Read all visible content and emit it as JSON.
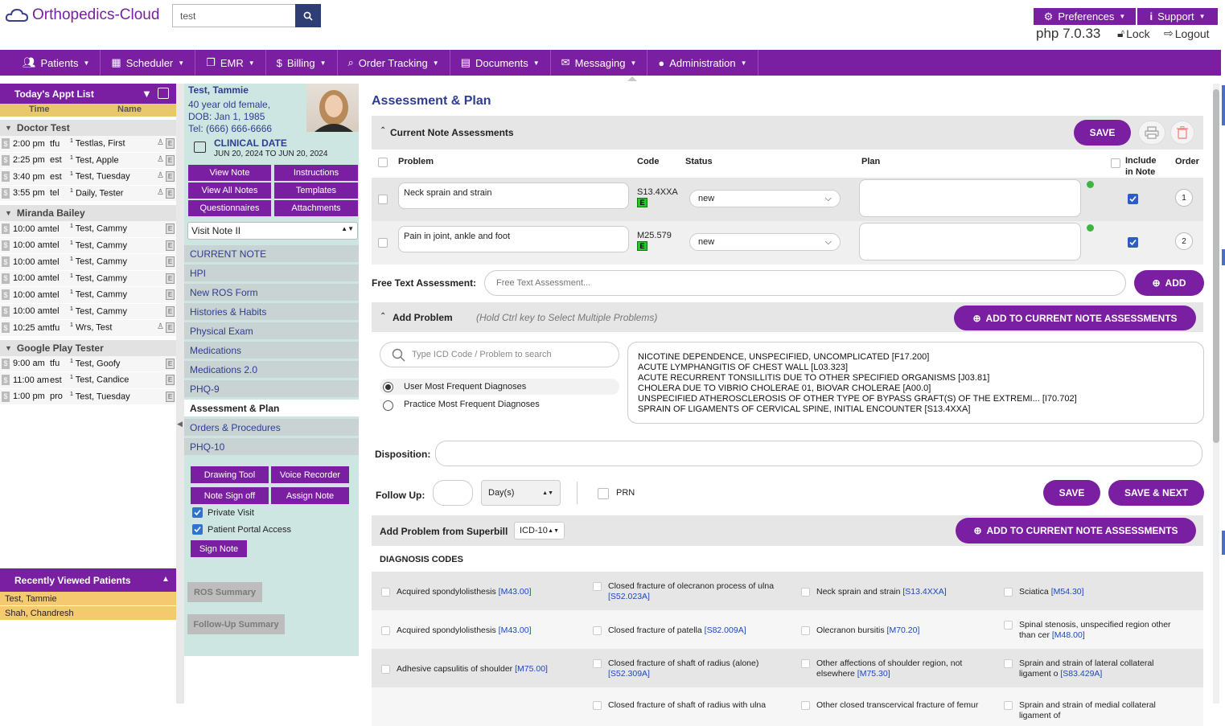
{
  "header": {
    "logo_text": "Orthopedics-Cloud",
    "search_value": "test",
    "preferences_label": "Preferences",
    "support_label": "Support",
    "version": "php 7.0.33",
    "lock_label": "Lock",
    "logout_label": "Logout",
    "accent_color": "#7a1fa2"
  },
  "nav": [
    {
      "label": "Patients",
      "icon": "users-icon"
    },
    {
      "label": "Scheduler",
      "icon": "calendar-icon"
    },
    {
      "label": "EMR",
      "icon": "copy-icon"
    },
    {
      "label": "Billing",
      "icon": "dollar-icon"
    },
    {
      "label": "Order Tracking",
      "icon": "search-icon"
    },
    {
      "label": "Documents",
      "icon": "document-icon"
    },
    {
      "label": "Messaging",
      "icon": "envelope-icon"
    },
    {
      "label": "Administration",
      "icon": "user-icon"
    }
  ],
  "appt": {
    "title": "Today's Appt List",
    "col_time": "Time",
    "col_name": "Name",
    "groups": [
      {
        "provider": "Doctor Test",
        "items": [
          {
            "time": "2:00 pm",
            "type": "tfu",
            "sup": "1",
            "name": "Testlas, First"
          },
          {
            "time": "2:25 pm",
            "type": "est",
            "sup": "1",
            "name": "Test, Apple"
          },
          {
            "time": "3:40 pm",
            "type": "est",
            "sup": "1",
            "name": "Test, Tuesday"
          },
          {
            "time": "3:55 pm",
            "type": "tel",
            "sup": "1",
            "name": "Daily, Tester"
          }
        ]
      },
      {
        "provider": "Miranda Bailey",
        "items": [
          {
            "time": "10:00 am",
            "type": "tel",
            "sup": "1",
            "name": "Test, Cammy"
          },
          {
            "time": "10:00 am",
            "type": "tel",
            "sup": "1",
            "name": "Test, Cammy"
          },
          {
            "time": "10:00 am",
            "type": "tel",
            "sup": "1",
            "name": "Test, Cammy"
          },
          {
            "time": "10:00 am",
            "type": "tel",
            "sup": "1",
            "name": "Test, Cammy"
          },
          {
            "time": "10:00 am",
            "type": "tel",
            "sup": "1",
            "name": "Test, Cammy"
          },
          {
            "time": "10:00 am",
            "type": "tel",
            "sup": "1",
            "name": "Test, Cammy"
          },
          {
            "time": "10:25 am",
            "type": "tfu",
            "sup": "1",
            "name": "Wrs, Test"
          }
        ]
      },
      {
        "provider": "Google Play Tester",
        "items": [
          {
            "time": "9:00 am",
            "type": "tfu",
            "sup": "1",
            "name": "Test, Goofy"
          },
          {
            "time": "11:00 am",
            "type": "est",
            "sup": "1",
            "name": "Test, Candice"
          },
          {
            "time": "1:00 pm",
            "type": "pro",
            "sup": "1",
            "name": "Test, Tuesday"
          }
        ]
      }
    ],
    "e_label": "E"
  },
  "recent": {
    "title": "Recently Viewed Patients",
    "items": [
      "Test, Tammie",
      "Shah, Chandresh"
    ]
  },
  "patient": {
    "name": "Test, Tammie",
    "line1": "40 year old female,",
    "line2": "DOB: Jan 1, 1985",
    "line3": "Tel: (666) 666-6666",
    "clinical_date_label": "CLINICAL DATE",
    "clinical_date_range": "JUN 20, 2024 TO JUN 20, 2024"
  },
  "sidebar": {
    "buttons": [
      "View Note",
      "Instructions",
      "View All Notes",
      "Templates",
      "Questionnaires",
      "Attachments"
    ],
    "visit_note": "Visit Note II",
    "links": [
      "CURRENT NOTE",
      "HPI",
      "New ROS Form",
      "Histories & Habits",
      "Physical Exam",
      "Medications",
      "Medications 2.0",
      "PHQ-9",
      "Assessment & Plan",
      "Orders & Procedures",
      "PHQ-10"
    ],
    "tool_buttons": [
      "Drawing Tool",
      "Voice Recorder",
      "Note Sign off",
      "Assign Note"
    ],
    "private_visit": "Private Visit",
    "portal_access": "Patient Portal Access",
    "sign_note": "Sign Note",
    "ros_summary": "ROS Summary",
    "followup_summary": "Follow-Up Summary"
  },
  "main": {
    "title": "Assessment & Plan",
    "current_note_label": "Current Note Assessments",
    "save_label": "SAVE",
    "col_problem": "Problem",
    "col_code": "Code",
    "col_status": "Status",
    "col_plan": "Plan",
    "col_include": "Include in Note",
    "col_order": "Order",
    "rows": [
      {
        "problem": "Neck sprain and strain",
        "code": "S13.4XXA",
        "status": "new",
        "order": "1"
      },
      {
        "problem": "Pain in joint, ankle and foot",
        "code": "M25.579",
        "status": "new",
        "order": "2"
      }
    ],
    "e_badge": "E",
    "free_text_label": "Free Text Assessment:",
    "free_text_placeholder": "Free Text Assessment...",
    "add_label": "ADD",
    "add_problem_label": "Add Problem",
    "add_problem_hint": "(Hold Ctrl key to Select Multiple Problems)",
    "add_to_current": "ADD TO CURRENT NOTE ASSESSMENTS",
    "icd_placeholder": "Type ICD Code / Problem to search",
    "radio_user": "User Most Frequent Diagnoses",
    "radio_practice": "Practice Most Frequent Diagnoses",
    "frequent_list": [
      "NICOTINE DEPENDENCE, UNSPECIFIED, UNCOMPLICATED [F17.200]",
      "ACUTE LYMPHANGITIS OF CHEST WALL [L03.323]",
      "ACUTE RECURRENT TONSILLITIS DUE TO OTHER SPECIFIED ORGANISMS [J03.81]",
      "CHOLERA DUE TO VIBRIO CHOLERAE 01, BIOVAR CHOLERAE [A00.0]",
      "UNSPECIFIED ATHEROSCLEROSIS OF OTHER TYPE OF BYPASS GRAFT(S) OF THE EXTREMI... [I70.702]",
      "SPRAIN OF LIGAMENTS OF CERVICAL SPINE, INITIAL ENCOUNTER [S13.4XXA]"
    ],
    "disposition_label": "Disposition:",
    "followup_label": "Follow Up:",
    "days_option": "Day(s)",
    "prn_label": "PRN",
    "save_next_label": "SAVE & NEXT",
    "superbill_label": "Add Problem from Superbill",
    "icd_version": "ICD-10",
    "diag_codes_label": "DIAGNOSIS CODES",
    "diag_rows": [
      [
        {
          "text": "Acquired spondylolisthesis",
          "code": "[M43.00]"
        },
        {
          "text": "Closed fracture of olecranon process of ulna",
          "code": "[S52.023A]"
        },
        {
          "text": "Neck sprain and strain",
          "code": "[S13.4XXA]"
        },
        {
          "text": "Sciatica",
          "code": "[M54.30]"
        }
      ],
      [
        {
          "text": "Acquired spondylolisthesis",
          "code": "[M43.00]"
        },
        {
          "text": "Closed fracture of patella",
          "code": "[S82.009A]"
        },
        {
          "text": "Olecranon bursitis",
          "code": "[M70.20]"
        },
        {
          "text": "Spinal stenosis, unspecified region other than cer",
          "code": "[M48.00]"
        }
      ],
      [
        {
          "text": "Adhesive capsulitis of shoulder",
          "code": "[M75.00]"
        },
        {
          "text": "Closed fracture of shaft of radius (alone)",
          "code": "[S52.309A]"
        },
        {
          "text": "Other affections of shoulder region, not elsewhere",
          "code": "[M75.30]"
        },
        {
          "text": "Sprain and strain of lateral collateral ligament o",
          "code": "[S83.429A]"
        }
      ],
      [
        {
          "text": "",
          "code": ""
        },
        {
          "text": "Closed fracture of shaft of radius with ulna",
          "code": ""
        },
        {
          "text": "Other closed transcervical fracture of femur",
          "code": ""
        },
        {
          "text": "Sprain and strain of medial collateral ligament of",
          "code": ""
        }
      ]
    ]
  }
}
